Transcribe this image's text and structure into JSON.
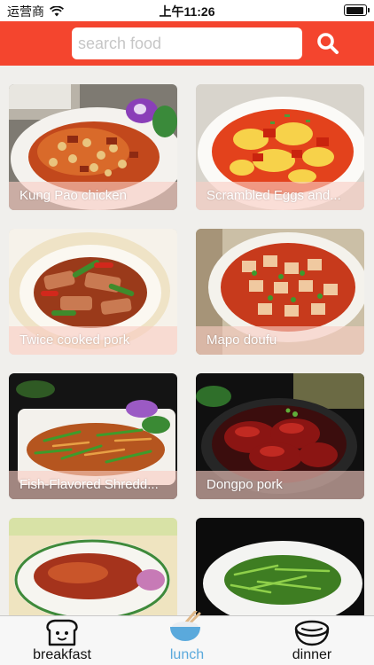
{
  "status_bar": {
    "carrier": "运营商",
    "time": "上午11:26",
    "battery_level": 0.95
  },
  "search": {
    "placeholder": "search food",
    "value": "",
    "button_icon": "search-icon"
  },
  "colors": {
    "header": "#f4452e",
    "tab_active": "#5aa9dc",
    "caption_band": "rgba(248,205,195,0.62)"
  },
  "dishes": [
    {
      "name": "Kung Pao chicken"
    },
    {
      "name": "Scrambled Eggs and..."
    },
    {
      "name": "Twice cooked pork"
    },
    {
      "name": "Mapo doufu"
    },
    {
      "name": "Fish-Flavored Shredd..."
    },
    {
      "name": "Dongpo pork"
    },
    {
      "name": ""
    },
    {
      "name": ""
    }
  ],
  "tabs": [
    {
      "label": "breakfast",
      "icon": "bread-icon",
      "active": false
    },
    {
      "label": "lunch",
      "icon": "bowl-icon",
      "active": true
    },
    {
      "label": "dinner",
      "icon": "plate-icon",
      "active": false
    }
  ]
}
